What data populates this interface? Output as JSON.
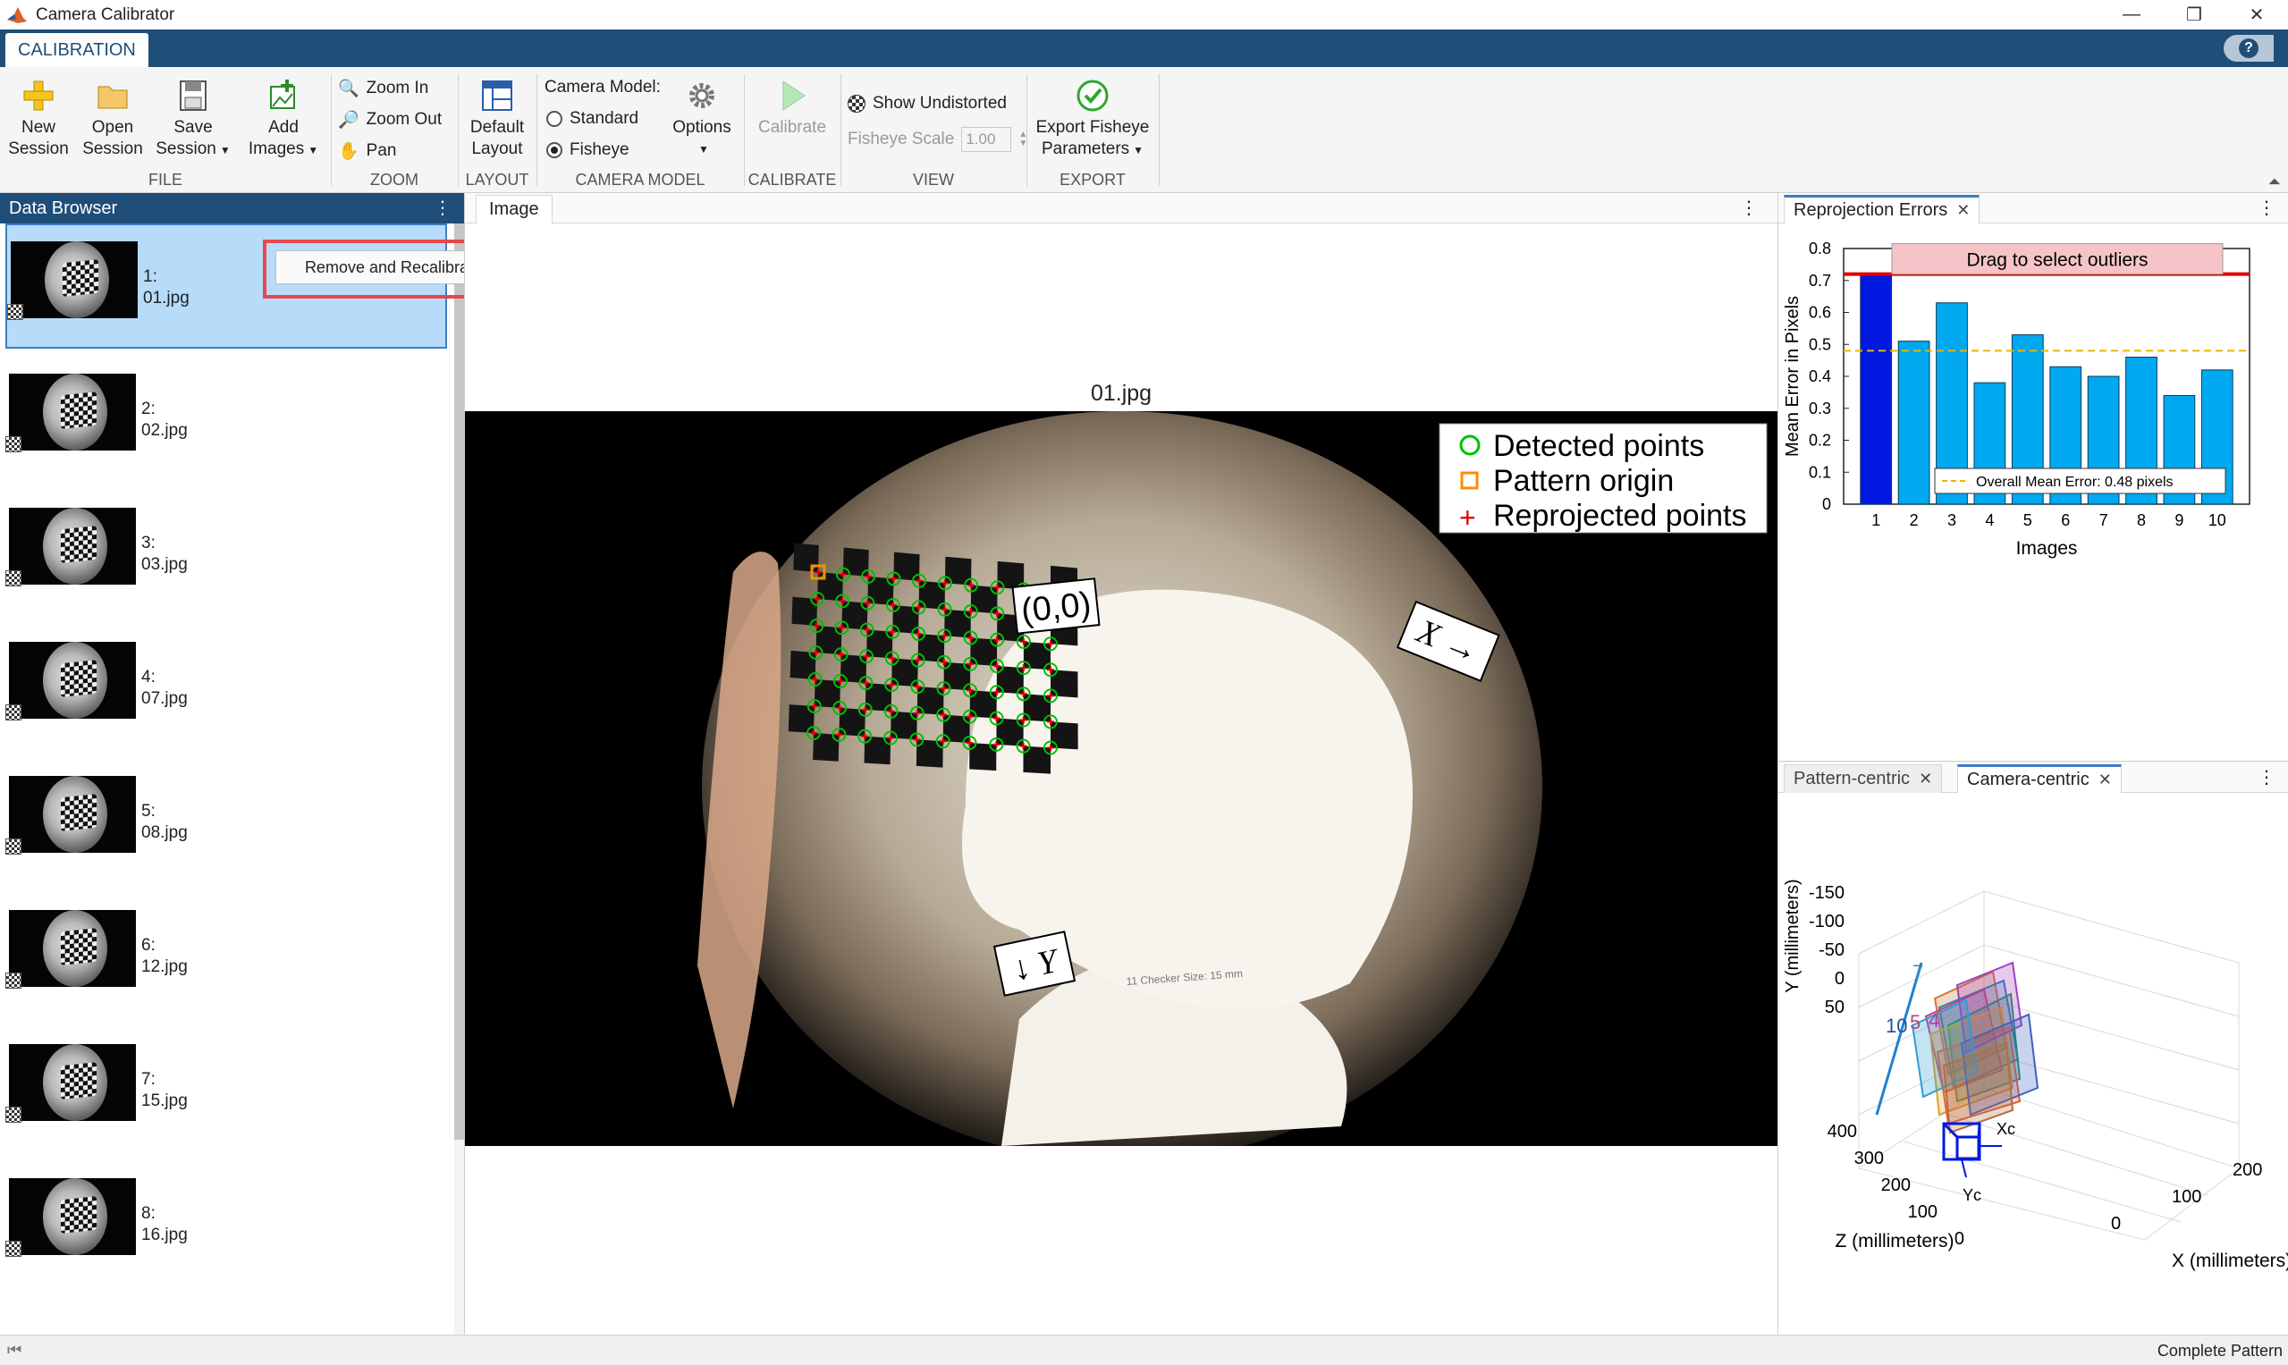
{
  "window": {
    "title": "Camera Calibrator",
    "minimize": "—",
    "restore": "❐",
    "close": "✕"
  },
  "tabs": {
    "calibration": "CALIBRATION",
    "help": "?"
  },
  "toolstrip": {
    "file": {
      "label": "FILE",
      "new_session": [
        "New",
        "Session"
      ],
      "open_session": [
        "Open",
        "Session"
      ],
      "save_session": [
        "Save",
        "Session"
      ],
      "add_images": [
        "Add",
        "Images"
      ]
    },
    "zoom": {
      "label": "ZOOM",
      "zoom_in": "Zoom In",
      "zoom_out": "Zoom Out",
      "pan": "Pan"
    },
    "layout": {
      "label": "LAYOUT",
      "default_layout": [
        "Default",
        "Layout"
      ]
    },
    "camera_model": {
      "label": "CAMERA MODEL",
      "heading": "Camera Model:",
      "standard": "Standard",
      "fisheye": "Fisheye",
      "selected": "Fisheye",
      "options": "Options"
    },
    "calibrate": {
      "label": "CALIBRATE",
      "calibrate": "Calibrate"
    },
    "view": {
      "label": "VIEW",
      "show_undistorted": "Show Undistorted",
      "fisheye_scale_label": "Fisheye Scale",
      "fisheye_scale_value": "1.00"
    },
    "export": {
      "label": "EXPORT",
      "export_button": [
        "Export Fisheye",
        "Parameters"
      ]
    }
  },
  "data_browser": {
    "title": "Data Browser",
    "menu": "⋮",
    "context_menu_item": "Remove and Recalibrate",
    "selected_index": 0,
    "items": [
      {
        "index": "1:",
        "file": "01.jpg"
      },
      {
        "index": "2:",
        "file": "02.jpg"
      },
      {
        "index": "3:",
        "file": "03.jpg"
      },
      {
        "index": "4:",
        "file": "07.jpg"
      },
      {
        "index": "5:",
        "file": "08.jpg"
      },
      {
        "index": "6:",
        "file": "12.jpg"
      },
      {
        "index": "7:",
        "file": "15.jpg"
      },
      {
        "index": "8:",
        "file": "16.jpg"
      }
    ]
  },
  "image_panel": {
    "tab": "Image",
    "menu": "⋮",
    "image_title": "01.jpg",
    "legend": [
      "Detected points",
      "Pattern origin",
      "Reprojected points"
    ],
    "origin_label": "(0,0)",
    "x_label": "X →",
    "y_label": "↓ Y",
    "board_caption": "11 Checker Size: 15 mm",
    "colors": {
      "detected": "#00c000",
      "origin": "#ff8c00",
      "reprojected": "#e00000"
    }
  },
  "reprojection_panel": {
    "tab": "Reprojection Errors",
    "close": "✕",
    "menu": "⋮",
    "drag_hint": "Drag to select outliers",
    "chart_data": {
      "type": "bar",
      "categories": [
        "1",
        "2",
        "3",
        "4",
        "5",
        "6",
        "7",
        "8",
        "9",
        "10"
      ],
      "values": [
        0.72,
        0.51,
        0.63,
        0.38,
        0.53,
        0.43,
        0.4,
        0.46,
        0.34,
        0.42
      ],
      "highlighted": [
        1
      ],
      "threshold": 0.72,
      "overall_mean": 0.48,
      "overall_label": "Overall Mean Error: 0.48 pixels",
      "xlabel": "Images",
      "ylabel": "Mean Error in Pixels",
      "ylim": [
        0,
        0.8
      ],
      "yticks": [
        "0",
        "0.1",
        "0.2",
        "0.3",
        "0.4",
        "0.5",
        "0.6",
        "0.7",
        "0.8"
      ],
      "colors": {
        "bar": "#00a8f0",
        "selected": "#0018e0",
        "threshold": "#e00000",
        "mean": "#e8b800"
      }
    }
  },
  "extrinsics_panel": {
    "tabs": [
      "Pattern-centric",
      "Camera-centric"
    ],
    "active_tab": "Camera-centric",
    "close": "✕",
    "menu": "⋮",
    "ylabel": "Y (millimeters)",
    "zlabel": "Z (millimeters)",
    "xlabel": "X (millimeters)",
    "yticks": [
      "-150",
      "-100",
      "-50",
      "0",
      "50"
    ],
    "zticks": [
      "400",
      "300",
      "200",
      "100",
      "0"
    ],
    "xticks": [
      "0",
      "100",
      "200"
    ],
    "axis_xc": "Xc",
    "axis_yc": "Yc",
    "plane_labels": [
      "10",
      "5",
      "7",
      "4"
    ]
  },
  "status": {
    "text": "Complete Pattern"
  }
}
